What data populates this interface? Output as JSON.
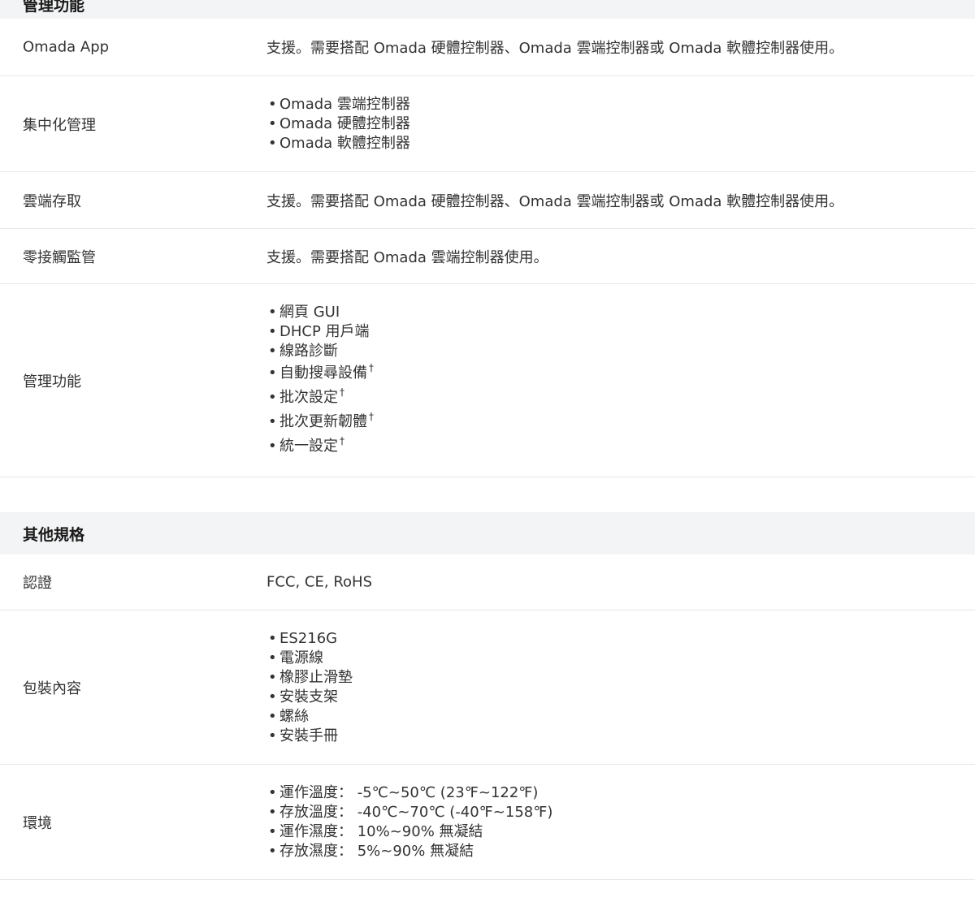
{
  "mgmt_section": {
    "title": "管理功能",
    "rows": [
      {
        "label": "Omada App",
        "value": "支援。需要搭配 Omada 硬體控制器、Omada 雲端控制器或 Omada 軟體控制器使用。"
      },
      {
        "label": "集中化管理",
        "items": [
          "Omada 雲端控制器",
          "Omada 硬體控制器",
          "Omada 軟體控制器"
        ]
      },
      {
        "label": "雲端存取",
        "value": "支援。需要搭配 Omada 硬體控制器、Omada 雲端控制器或 Omada 軟體控制器使用。"
      },
      {
        "label": "零接觸監管",
        "value": "支援。需要搭配 Omada 雲端控制器使用。"
      },
      {
        "label": "管理功能",
        "items": [
          "網頁 GUI",
          "DHCP 用戶端",
          "線路診斷",
          "自動搜尋設備",
          "批次設定",
          "批次更新韌體",
          "統一設定"
        ],
        "footnote_mark": "†"
      }
    ]
  },
  "other_section": {
    "title": "其他規格",
    "rows": [
      {
        "label": "認證",
        "value": "FCC, CE, RoHS"
      },
      {
        "label": "包裝內容",
        "items": [
          "ES216G",
          "電源線",
          "橡膠止滑墊",
          "安裝支架",
          "螺絲",
          "安裝手冊"
        ]
      },
      {
        "label": "環境",
        "items": [
          "運作溫度： -5℃~50℃ (23℉~122℉)",
          "存放溫度： -40℃~70℃ (-40℉~158℉)",
          "運作濕度： 10%~90% 無凝結",
          "存放濕度： 5%~90% 無凝結"
        ]
      }
    ]
  }
}
